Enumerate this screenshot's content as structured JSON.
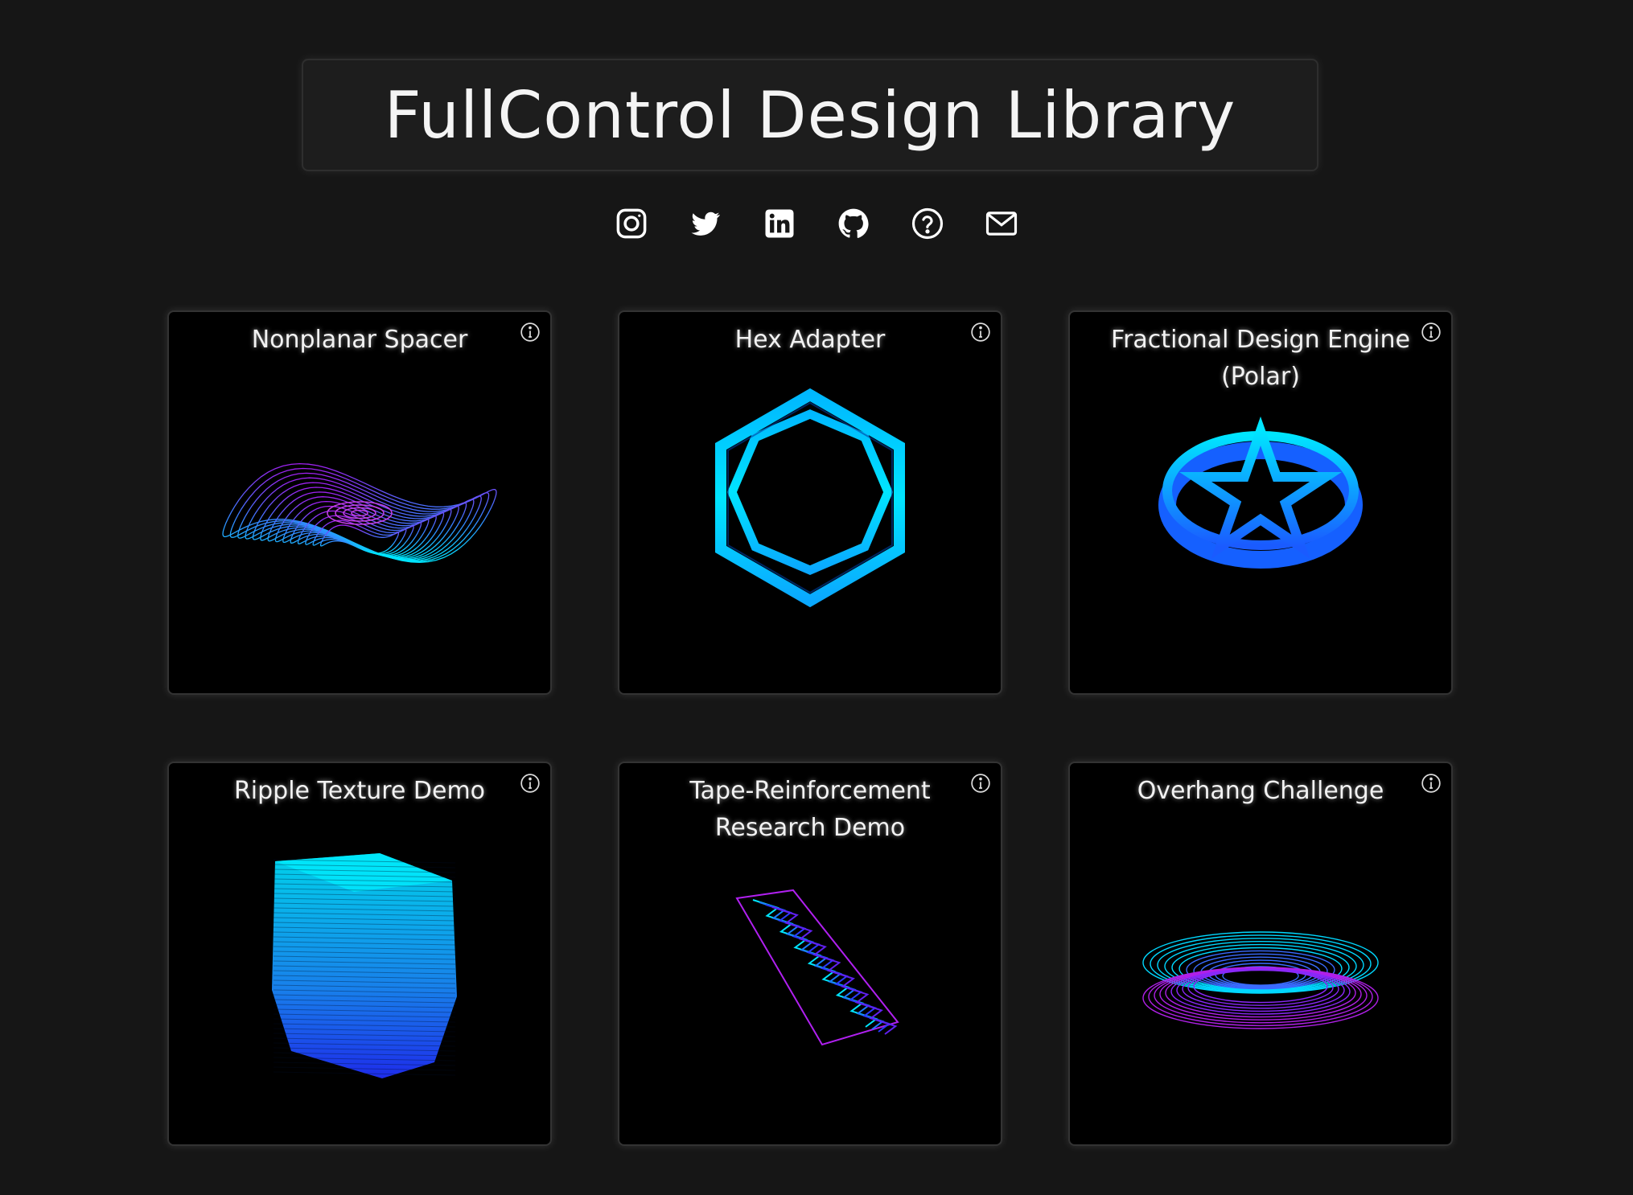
{
  "header": {
    "title": "FullControl Design Library"
  },
  "socials": [
    {
      "icon": "instagram-icon"
    },
    {
      "icon": "twitter-icon"
    },
    {
      "icon": "linkedin-icon"
    },
    {
      "icon": "github-icon"
    },
    {
      "icon": "help-icon"
    },
    {
      "icon": "mail-icon"
    }
  ],
  "cards": [
    {
      "title": "Nonplanar Spacer"
    },
    {
      "title": "Hex Adapter"
    },
    {
      "title": "Fractional Design Engine (Polar)"
    },
    {
      "title": "Ripple Texture Demo"
    },
    {
      "title": "Tape-Reinforcement Research Demo"
    },
    {
      "title": "Overhang Challenge"
    }
  ],
  "colors": {
    "background": "#161616",
    "card": "#000000",
    "cyan": "#00e5ff",
    "blue": "#1a4bff",
    "purple": "#a020f0"
  }
}
